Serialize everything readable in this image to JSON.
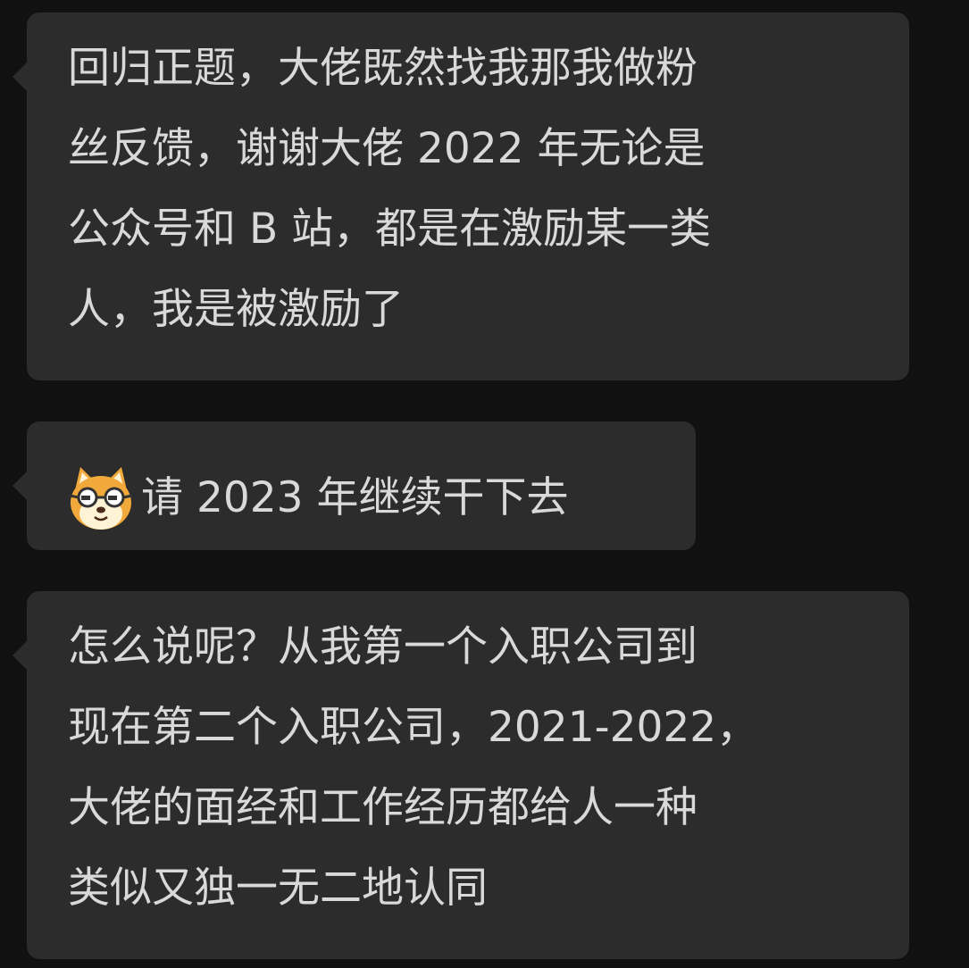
{
  "messages": [
    {
      "lines": [
        "回归正题，大佬既然找我那我做粉",
        "丝反馈，谢谢大佬 2022 年无论是",
        "公众号和 B 站，都是在激励某一类",
        "人，我是被激励了"
      ]
    },
    {
      "emoji": "doge-cat-glasses-emoji",
      "text": "请 2023 年继续干下去"
    },
    {
      "lines": [
        "怎么说呢？从我第一个入职公司到",
        "现在第二个入职公司，2021-2022，",
        "大佬的面经和工作经历都给人一种",
        "类似又独一无二地认同"
      ]
    }
  ],
  "colors": {
    "background": "#111111",
    "bubble": "#2c2c2c",
    "text": "#d9d9d9"
  }
}
